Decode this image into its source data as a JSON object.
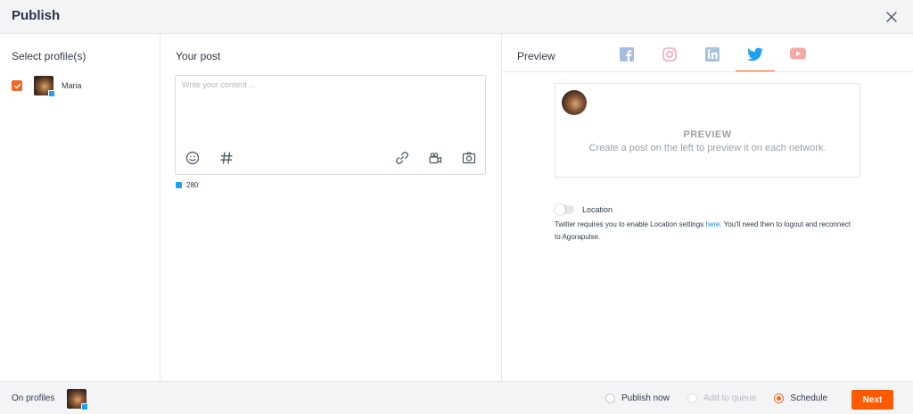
{
  "header": {
    "title": "Publish",
    "close_icon": "close-icon"
  },
  "profiles": {
    "label": "Select profile(s)",
    "items": [
      {
        "name": "Maria",
        "checked": true,
        "network": "twitter"
      }
    ]
  },
  "post": {
    "label": "Your post",
    "placeholder": "Write your content ...",
    "value": "",
    "tools": [
      "emoji-icon",
      "hashtag-icon",
      "link-icon",
      "video-icon",
      "camera-icon"
    ],
    "char_count": "280"
  },
  "preview": {
    "label": "Preview",
    "tabs": [
      {
        "name": "facebook",
        "active": false,
        "color": "#a9bde3"
      },
      {
        "name": "instagram",
        "active": false,
        "color": "#f3a8bb"
      },
      {
        "name": "linkedin",
        "active": false,
        "color": "#a9c3dc"
      },
      {
        "name": "twitter",
        "active": true,
        "color": "#1da1f2"
      },
      {
        "name": "youtube",
        "active": false,
        "color": "#f7a8a8"
      }
    ],
    "card_heading": "PREVIEW",
    "card_text": "Create a post on the left to preview it on each network.",
    "location": {
      "label": "Location",
      "enabled": false,
      "note_before": "Twitter requires you to enable Location settings ",
      "note_link": "here",
      "note_after": ". You'll need then to logout and reconnect to Agorapulse."
    }
  },
  "footer": {
    "on_profiles_label": "On profiles",
    "options": [
      {
        "label": "Publish now",
        "selected": false,
        "disabled": false
      },
      {
        "label": "Add to queue",
        "selected": false,
        "disabled": true
      },
      {
        "label": "Schedule",
        "selected": true,
        "disabled": false
      }
    ],
    "next_label": "Next"
  },
  "colors": {
    "accent": "#ff5a00",
    "twitter": "#1da1f2",
    "link": "#1d8ed8"
  }
}
